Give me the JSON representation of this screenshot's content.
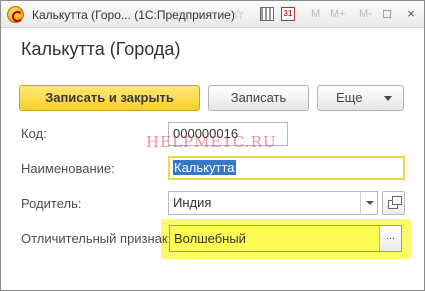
{
  "window": {
    "title": "Калькутта (Горо... (1С:Предприятие)",
    "toolbar": {
      "favorite_icon": "star-icon",
      "calculator_icon": "calculator-icon",
      "calendar_icon": "calendar-icon",
      "calendar_label": "31",
      "mem_m": "M",
      "mem_m_plus": "M+",
      "mem_m_minus": "M-",
      "minimize_symbol": "□",
      "close_symbol": "×"
    }
  },
  "form": {
    "title": "Калькутта (Города)",
    "commands": {
      "save_and_close": "Записать и закрыть",
      "save": "Записать",
      "more": "Еще"
    },
    "fields": {
      "code": {
        "label": "Код:",
        "value": "000000016"
      },
      "name": {
        "label": "Наименование:",
        "value": "Калькутта"
      },
      "parent": {
        "label": "Родитель:",
        "value": "Индия"
      },
      "attribute": {
        "label": "Отличительный признак:",
        "value": "Волшебный",
        "select_button": "..."
      }
    }
  },
  "watermark": "HELPME1C.RU",
  "colors": {
    "primary_button": "#f9cf2c",
    "highlight": "#fbfb66",
    "selection": "#3478c9",
    "watermark": "#dc3c50"
  }
}
